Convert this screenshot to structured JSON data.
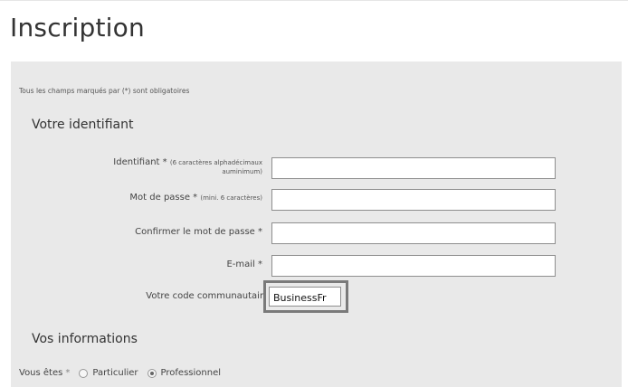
{
  "page": {
    "title": "Inscription"
  },
  "form": {
    "required_note": "Tous les champs marqués par (*) sont obligatoires",
    "section_identifiant": "Votre identifiant",
    "identifiant": {
      "label": "Identifiant *",
      "hint_line1": "(6 caractères alphadécimaux",
      "hint_line2": "auminimum)",
      "value": ""
    },
    "password": {
      "label": "Mot de passe *",
      "hint": "(mini. 6 caractères)",
      "value": ""
    },
    "confirm_password": {
      "label": "Confirmer le mot de passe *",
      "value": ""
    },
    "email": {
      "label": "E-mail *",
      "value": ""
    },
    "community_code": {
      "label": "Votre code communautaire",
      "value": "BusinessFr"
    },
    "section_informations": "Vos informations",
    "vous_etes": {
      "label": "Vous êtes",
      "required": "*",
      "options": [
        "Particulier",
        "Professionnel"
      ],
      "selected": "Professionnel"
    }
  }
}
